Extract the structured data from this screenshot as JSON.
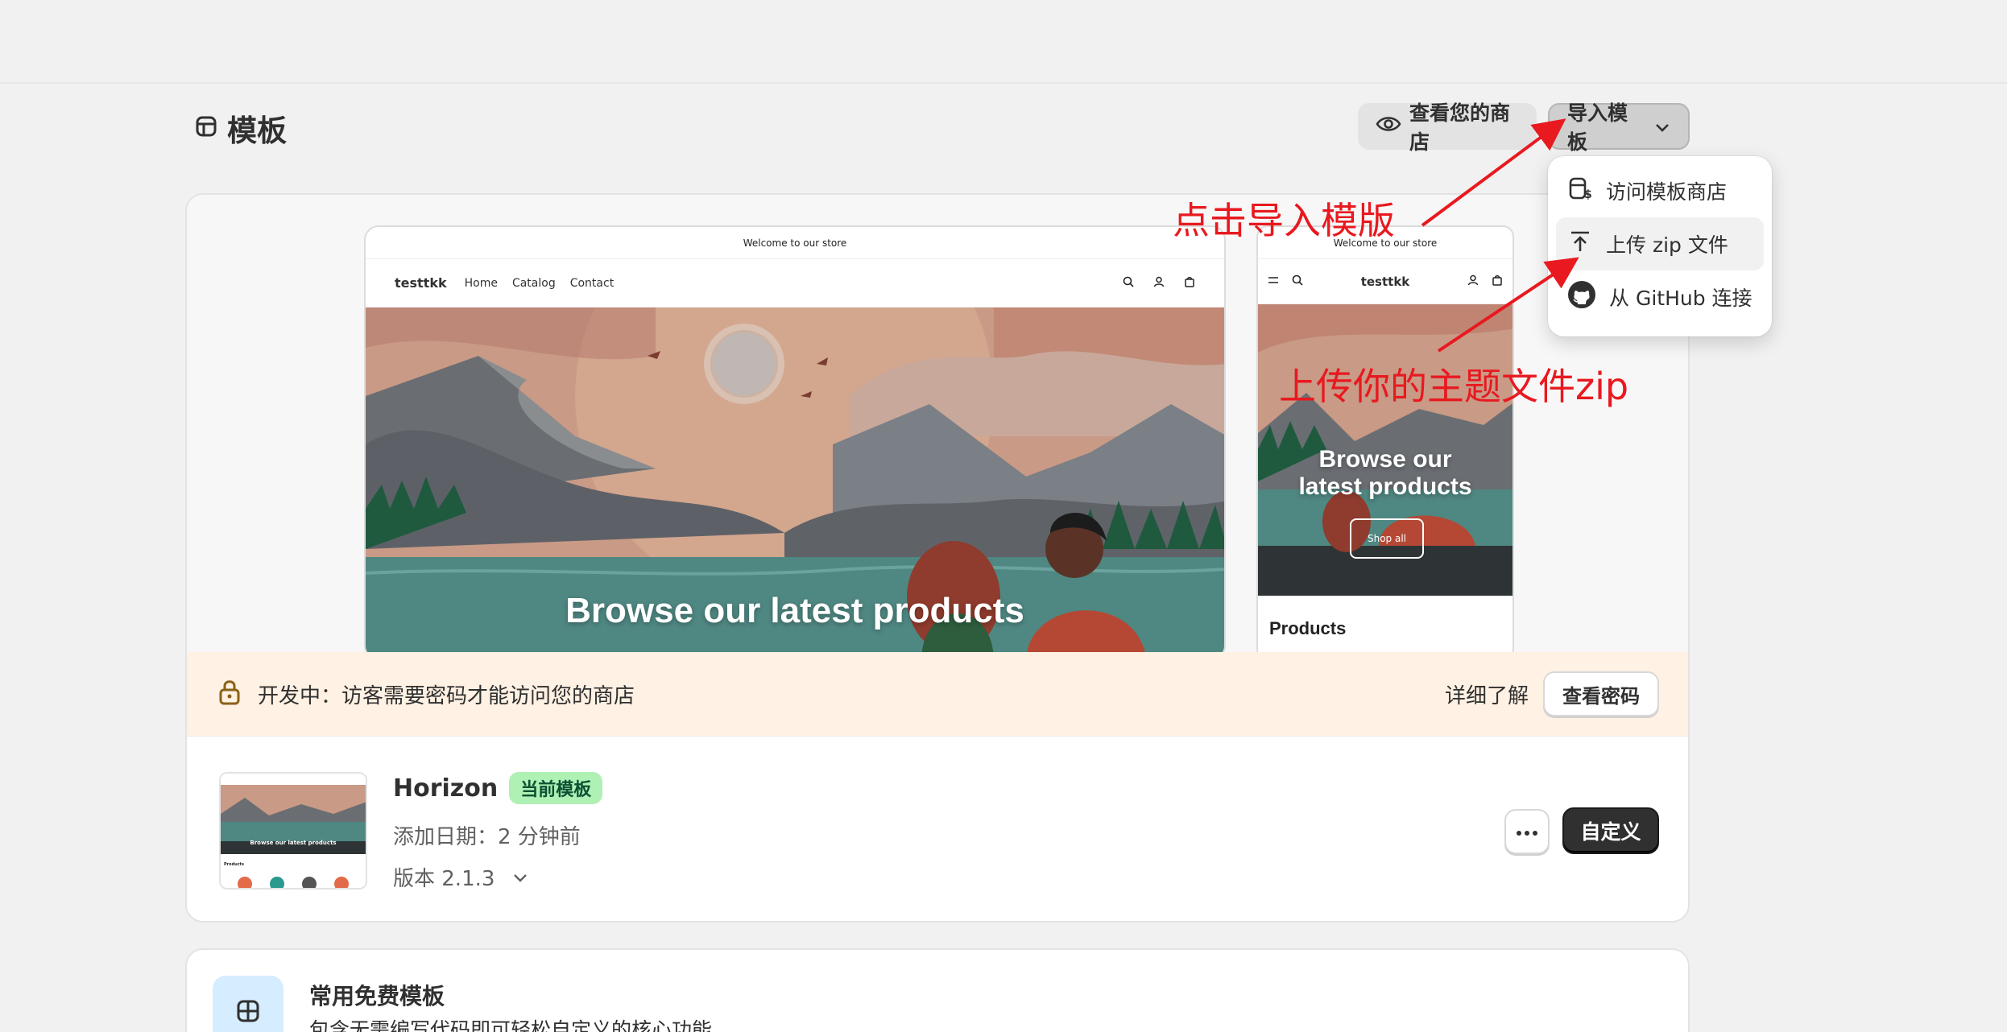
{
  "header": {
    "title": "模板",
    "view_store_label": "查看您的商店",
    "import_label": "导入模板"
  },
  "preview": {
    "announcement": "Welcome to our store",
    "store_name": "testtkk",
    "nav": [
      "Home",
      "Catalog",
      "Contact"
    ],
    "hero_title": "Browse our latest products",
    "mobile_hero_title_l1": "Browse our",
    "mobile_hero_title_l2": "latest products",
    "shop_all": "Shop all",
    "products_label": "Products"
  },
  "dev_banner": {
    "message": "开发中：访客需要密码才能访问您的商店",
    "learn_more": "详细了解",
    "view_password": "查看密码"
  },
  "theme": {
    "name": "Horizon",
    "badge": "当前模板",
    "added": "添加日期：2 分钟前",
    "version": "版本 2.1.3",
    "customize": "自定义",
    "thumb_title": "Browse our latest products",
    "thumb_products": "Products"
  },
  "free_themes": {
    "title": "常用免费模板",
    "description": "包含无需编写代码即可轻松自定义的核心功能。"
  },
  "dropdown": {
    "items": [
      {
        "label": "访问模板商店",
        "icon": "theme-store-icon"
      },
      {
        "label": "上传 zip 文件",
        "icon": "upload-icon"
      },
      {
        "label": "从 GitHub 连接",
        "icon": "github-icon"
      }
    ]
  },
  "annotations": {
    "click_import": "点击导入模版",
    "upload_zip": "上传你的主题文件zip"
  },
  "colors": {
    "accent_dark": "#303030",
    "badge_green": "#aff0b5",
    "banner_bg": "#fff1e3",
    "annotation_red": "#e8191f"
  }
}
